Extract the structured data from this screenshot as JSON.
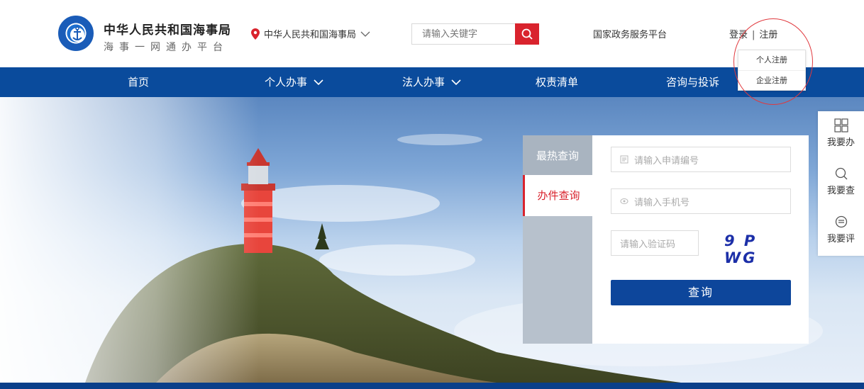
{
  "header": {
    "site_name": "中华人民共和国海事局",
    "site_sub": "海事一网通办平台",
    "location": "中华人民共和国海事局",
    "search_placeholder": "请输入关键字",
    "gov_link": "国家政务服务平台",
    "login": "登录",
    "separator": "|",
    "register": "注册"
  },
  "register_menu": {
    "items": [
      "个人注册",
      "企业注册"
    ]
  },
  "nav": {
    "items": [
      {
        "label": "首页"
      },
      {
        "label": "个人办事",
        "has_dropdown": true
      },
      {
        "label": "法人办事",
        "has_dropdown": true
      },
      {
        "label": "权责清单"
      },
      {
        "label": "咨询与投诉"
      }
    ]
  },
  "query": {
    "tabs": [
      "最热查询",
      "办件查询"
    ],
    "active_tab": "办件查询",
    "application_no_placeholder": "请输入申请编号",
    "phone_placeholder": "请输入手机号",
    "captcha_placeholder": "请输入验证码",
    "captcha_text": "9 P WG",
    "submit": "查询"
  },
  "side": {
    "items": [
      {
        "label": "我要办",
        "icon": "grid-icon"
      },
      {
        "label": "我要查",
        "icon": "search-icon"
      },
      {
        "label": "我要评",
        "icon": "comment-icon"
      }
    ]
  },
  "colors": {
    "brand_blue": "#0a4b9c",
    "accent_red": "#d9232d",
    "button_blue": "#0d469b"
  }
}
